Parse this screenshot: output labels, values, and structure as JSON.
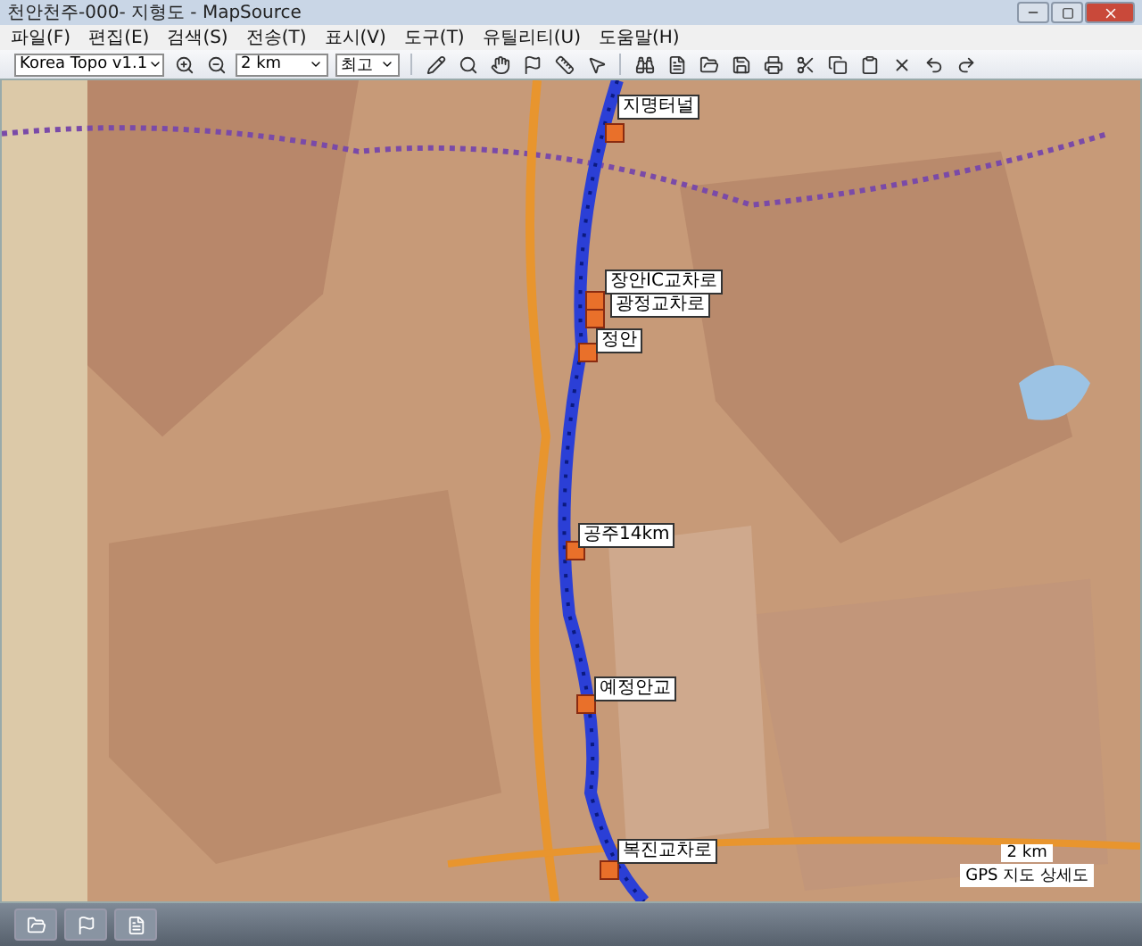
{
  "window": {
    "title": "천안천주-000- 지형도 - MapSource"
  },
  "menu": [
    "파일(F)",
    "편집(E)",
    "검색(S)",
    "전송(T)",
    "표시(V)",
    "도구(T)",
    "유틸리티(U)",
    "도움말(H)"
  ],
  "toolbar": {
    "map_product": "Korea Topo v1.1",
    "zoom": "2 km",
    "detail": "최고"
  },
  "waypoints": [
    {
      "name": "지명터널"
    },
    {
      "name": "장안IC교차로"
    },
    {
      "name": "광정교차로"
    },
    {
      "name": "정안"
    },
    {
      "name": "공주14km"
    },
    {
      "name": "예정안교"
    },
    {
      "name": "복진교차로"
    }
  ],
  "scale": {
    "label": "2 km",
    "caption": "GPS 지도 상세도"
  }
}
